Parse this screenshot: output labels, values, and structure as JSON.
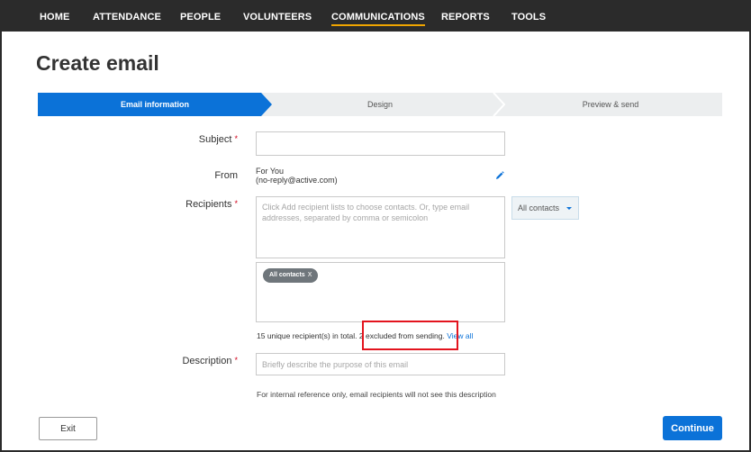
{
  "nav": {
    "items": [
      "HOME",
      "ATTENDANCE",
      "PEOPLE",
      "VOLUNTEERS",
      "COMMUNICATIONS",
      "REPORTS",
      "TOOLS"
    ],
    "active": "COMMUNICATIONS"
  },
  "page": {
    "title": "Create email"
  },
  "steps": [
    "Email information",
    "Design",
    "Preview & send"
  ],
  "form": {
    "subject": {
      "label": "Subject",
      "required_mark": "*",
      "value": ""
    },
    "from": {
      "label": "From",
      "name": "For You",
      "email": "(no-reply@active.com)"
    },
    "recipients": {
      "label": "Recipients",
      "required_mark": "*",
      "placeholder": "Click Add recipient lists to choose contacts. Or, type email addresses, separated by comma or semicolon",
      "list_dropdown": "All contacts",
      "chip": "All contacts",
      "chip_remove": "X",
      "summary_total": "15 unique recipient(s) in total.",
      "summary_excluded": "2 excluded from sending.",
      "view_all": "View all"
    },
    "description": {
      "label": "Description",
      "required_mark": "*",
      "placeholder": "Briefly describe the purpose of this email",
      "hint": "For internal reference only, email recipients will not see this description"
    }
  },
  "buttons": {
    "exit": "Exit",
    "continue": "Continue"
  },
  "colors": {
    "accent": "#0b72d8",
    "nav_bg": "#2b2b2b",
    "highlight": "#e3141e",
    "required": "#d0021b"
  }
}
